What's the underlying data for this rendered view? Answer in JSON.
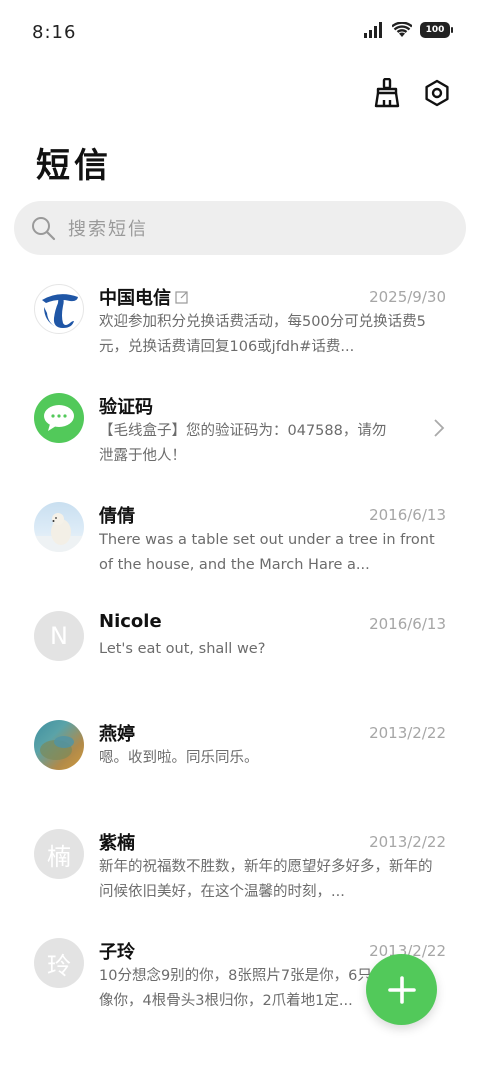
{
  "status_bar": {
    "time": "8:16",
    "battery": "100"
  },
  "header": {
    "title": "短信"
  },
  "search": {
    "placeholder": "搜索短信"
  },
  "messages": [
    {
      "name": "中国电信",
      "date": "2025/9/30",
      "preview": "欢迎参加积分兑换话费活动，每500分可兑换话费5元，兑换话费请回复106或jfdh#话费...",
      "avatar": "china-telecom-logo"
    },
    {
      "name": "验证码",
      "date": "",
      "preview": "【毛线盒子】您的验证码为：047588，请勿泄露于他人！",
      "avatar": "message-bubble"
    },
    {
      "name": "倩倩",
      "date": "2016/6/13",
      "preview": "There was a table set out under a tree in front of the house, and the March Hare a...",
      "avatar": "polar-bear-photo"
    },
    {
      "name": "Nicole",
      "date": "2016/6/13",
      "preview": "Let's eat out, shall we?",
      "avatar_letter": "N"
    },
    {
      "name": "燕婷",
      "date": "2013/2/22",
      "preview": "嗯。收到啦。同乐同乐。",
      "avatar": "landscape-photo"
    },
    {
      "name": "紫楠",
      "date": "2013/2/22",
      "preview": "新年的祝福数不胜数，新年的愿望好多好多，新年的问候依旧美好，在这个温馨的时刻，...",
      "avatar_letter": "楠"
    },
    {
      "name": "子玲",
      "date": "2013/2/22",
      "preview": "10分想念9别的你，8张照片7张是你，6只小狗5只像你，4根骨头3根归你，2爪着地1定...",
      "avatar_letter": "玲"
    }
  ],
  "colors": {
    "accent_green": "#52c95a",
    "telecom_blue": "#1f56a6"
  },
  "icons": [
    "signal-icon",
    "wifi-icon",
    "battery-icon",
    "broom-icon",
    "settings-icon",
    "search-icon",
    "edit-icon",
    "chevron-right-icon",
    "plus-icon"
  ]
}
